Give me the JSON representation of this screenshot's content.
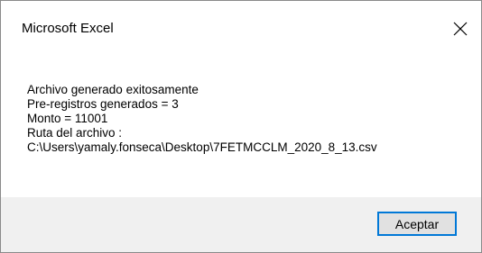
{
  "window": {
    "title": "Microsoft Excel",
    "close_icon": "close-icon"
  },
  "message": {
    "lines": [
      "Archivo generado exitosamente",
      "Pre-registros generados = 3",
      "Monto = 11001",
      "Ruta del archivo :",
      "C:\\Users\\yamaly.fonseca\\Desktop\\7FETMCCLM_2020_8_13.csv"
    ]
  },
  "footer": {
    "ok_label": "Aceptar"
  },
  "colors": {
    "button_border": "#0078d7",
    "button_bg": "#e1e1e1",
    "footer_bg": "#f0f0f0"
  }
}
